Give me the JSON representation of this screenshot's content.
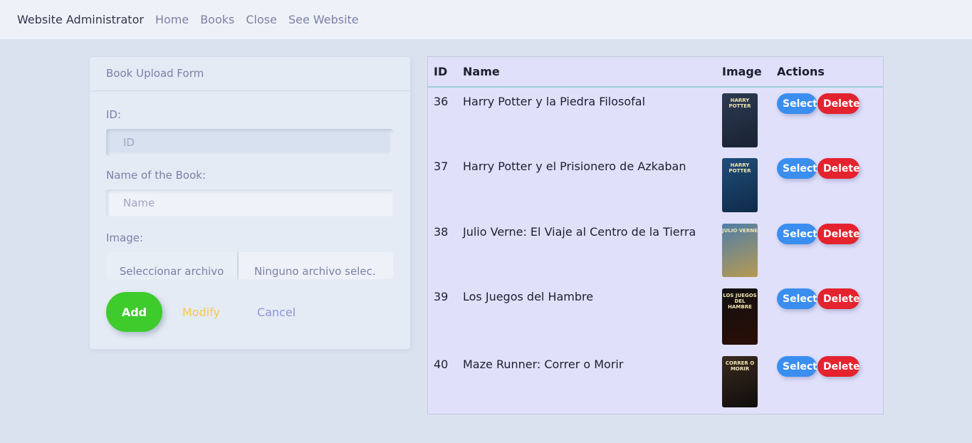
{
  "navbar": {
    "brand": "Website Administrator",
    "links": [
      "Home",
      "Books",
      "Close",
      "See Website"
    ]
  },
  "form": {
    "title": "Book Upload Form",
    "id_label": "ID:",
    "id_placeholder": "ID",
    "name_label": "Name of the Book:",
    "name_placeholder": "Name",
    "image_label": "Image:",
    "file_button": "Seleccionar archivo",
    "file_status": "Ninguno archivo selec.",
    "add_label": "Add",
    "modify_label": "Modify",
    "cancel_label": "Cancel"
  },
  "table": {
    "headers": [
      "ID",
      "Name",
      "Image",
      "Actions"
    ],
    "rows": [
      {
        "id": "36",
        "name": "Harry Potter y la Piedra Filosofal",
        "cover_colors": [
          "#2b3a52",
          "#1a2233"
        ],
        "cover_text": "HARRY POTTER"
      },
      {
        "id": "37",
        "name": "Harry Potter y el Prisionero de Azkaban",
        "cover_colors": [
          "#1f4e7a",
          "#0f2a48"
        ],
        "cover_text": "HARRY POTTER"
      },
      {
        "id": "38",
        "name": "Julio Verne: El Viaje al Centro de la Tierra",
        "cover_colors": [
          "#4f7ea8",
          "#b79a52"
        ],
        "cover_text": "JULIO VERNE"
      },
      {
        "id": "39",
        "name": "Los Juegos del Hambre",
        "cover_colors": [
          "#111111",
          "#2a0d05"
        ],
        "cover_text": "LOS JUEGOS DEL HAMBRE"
      },
      {
        "id": "40",
        "name": "Maze Runner: Correr o Morir",
        "cover_colors": [
          "#3a2a1e",
          "#0f0d0c"
        ],
        "cover_text": "CORRER O MORIR"
      }
    ],
    "select_label": "Select",
    "delete_label": "Delete"
  }
}
